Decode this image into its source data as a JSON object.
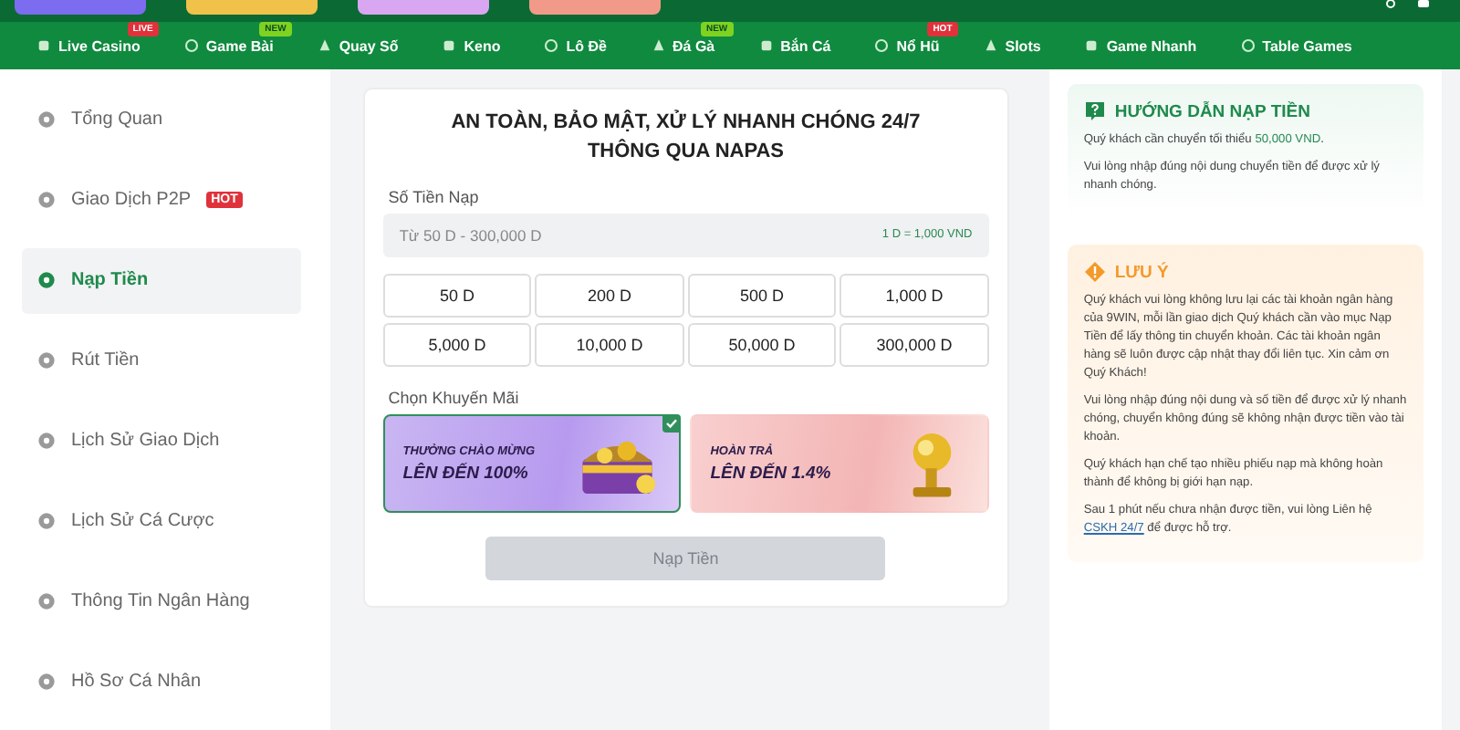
{
  "nav": {
    "items": [
      {
        "label": "Live Casino",
        "badge": {
          "text": "LIVE",
          "kind": "live"
        }
      },
      {
        "label": "Game Bài",
        "badge": {
          "text": "NEW",
          "kind": "new"
        }
      },
      {
        "label": "Quay Số"
      },
      {
        "label": "Keno"
      },
      {
        "label": "Lô Đề"
      },
      {
        "label": "Đá Gà",
        "badge": {
          "text": "NEW",
          "kind": "new"
        }
      },
      {
        "label": "Bắn Cá"
      },
      {
        "label": "Nổ Hũ",
        "badge": {
          "text": "HOT",
          "kind": "hot"
        }
      },
      {
        "label": "Slots"
      },
      {
        "label": "Game Nhanh"
      },
      {
        "label": "Table Games"
      }
    ]
  },
  "sidebar": {
    "items": [
      {
        "label": "Tổng Quan",
        "selected": false
      },
      {
        "label": "Giao Dịch P2P",
        "selected": false,
        "badge": "HOT"
      },
      {
        "label": "Nạp Tiền",
        "selected": true
      },
      {
        "label": "Rút Tiền",
        "selected": false
      },
      {
        "label": "Lịch Sử Giao Dịch",
        "selected": false
      },
      {
        "label": "Lịch Sử Cá Cược",
        "selected": false
      },
      {
        "label": "Thông Tin Ngân Hàng",
        "selected": false
      },
      {
        "label": "Hồ Sơ Cá Nhân",
        "selected": false
      }
    ]
  },
  "deposit": {
    "title": [
      "AN TOÀN, BẢO MẬT, XỬ LÝ NHANH CHÓNG 24/7",
      "THÔNG QUA NAPAS"
    ],
    "amount_label": "Số Tiền Nạp",
    "amount_field": {
      "placeholder": "Từ 50 D - 300,000 D",
      "rate": "1 D = 1,000 VND"
    },
    "amounts": [
      "50 D",
      "200 D",
      "500 D",
      "1,000 D",
      "5,000 D",
      "10,000 D",
      "50,000 D",
      "300,000 D"
    ],
    "promo_label": "Chọn Khuyến Mãi",
    "promos": [
      {
        "kind": "chest",
        "line1": "THƯỞNG CHÀO MỪNG",
        "line2": "LÊN ĐẾN 100%",
        "selected": true
      },
      {
        "kind": "gold",
        "line1": "HOÀN TRẢ",
        "line2": "LÊN ĐẾN 1.4%",
        "selected": false
      }
    ],
    "submit": {
      "label": "Nạp Tiền",
      "disabled": true
    }
  },
  "guide": {
    "title": "HƯỚNG DẪN NẠP TIỀN",
    "paragraphs": [
      [
        {
          "text": "Quý khách cần chuyển tối thiểu "
        },
        {
          "text": "50,000 VND",
          "kind": "highlight"
        },
        {
          "text": "."
        }
      ],
      [
        {
          "text": "Vui lòng nhập đúng nội dung chuyển tiền để được xử lý nhanh chóng."
        }
      ]
    ]
  },
  "notice": {
    "title": "LƯU Ý",
    "paragraphs": [
      [
        {
          "text": "Quý khách vui lòng không lưu lại các tài khoản ngân hàng của 9WIN, mỗi lần giao dịch Quý khách cần vào mục Nạp Tiền để lấy thông tin chuyển khoản. Các tài khoản ngân hàng sẽ luôn được cập nhật thay đổi liên tục. Xin cảm ơn Quý Khách!"
        }
      ],
      [
        {
          "text": "Vui lòng nhập đúng nội dung và số tiền để được xử lý nhanh chóng, chuyển không đúng sẽ không nhận được tiền vào tài khoản."
        }
      ],
      [
        {
          "text": "Quý khách hạn chế tạo nhiều phiếu nạp mà không hoàn thành để không bị giới hạn nạp."
        }
      ],
      [
        {
          "text": "Sau 1 phút nếu chưa nhận được tiền, vui lòng Liên hệ "
        },
        {
          "text": "CSKH 24/7",
          "kind": "link"
        },
        {
          "text": " để được hỗ trợ."
        }
      ]
    ]
  }
}
